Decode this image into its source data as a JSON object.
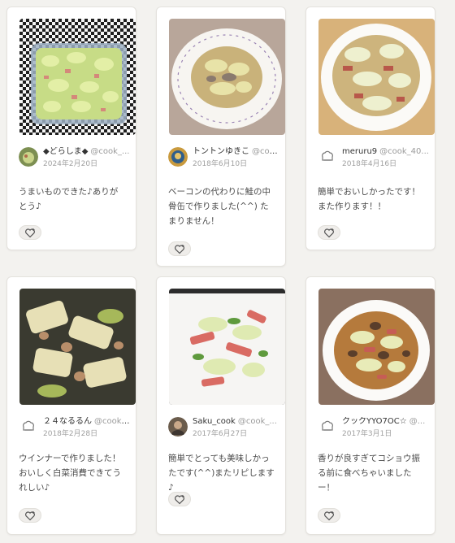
{
  "cards": [
    {
      "author": "◆どらしま◆",
      "handle": "@cook_...",
      "date": "2024年2月20日",
      "comment": "うまいものできた♪ありがとう♪",
      "avatar_icon": "food-photo-avatar",
      "photo_icon": "cabbage-bacon-glass-dish-photo"
    },
    {
      "author": "トントンゆきこ",
      "handle": "@coo...",
      "date": "2018年6月10日",
      "comment": "ベーコンの代わりに鮭の中骨缶で作りました(^^) たまりません！",
      "avatar_icon": "food-photo-avatar",
      "photo_icon": "cabbage-salmon-plate-photo"
    },
    {
      "author": "meruru9",
      "handle": "@cook_40...",
      "date": "2018年4月16日",
      "comment": "簡単でおいしかったです！また作ります！！",
      "avatar_icon": "chef-hat-icon",
      "photo_icon": "cabbage-bacon-white-plate-photo"
    },
    {
      "author": "２４なるるん",
      "handle": "@cook_...",
      "date": "2018年2月28日",
      "comment": "ウインナーで作りました！おいしく白菜消費できてうれしい♪",
      "avatar_icon": "chef-hat-icon",
      "photo_icon": "cabbage-sausage-photo"
    },
    {
      "author": "Saku_cook",
      "handle": "@cook_...",
      "date": "2017年6月27日",
      "comment": "簡単でとっても美味しかったです(^^)またリピします♪",
      "avatar_icon": "person-photo-avatar",
      "photo_icon": "cabbage-bacon-stirfry-photo"
    },
    {
      "author": "クックYYO7OC☆",
      "handle": "@...",
      "date": "2017年3月1日",
      "comment": "香りが良すぎてコショウ振る前に食べちゃいましたー！",
      "avatar_icon": "chef-hat-icon",
      "photo_icon": "cabbage-mushroom-bowl-photo"
    }
  ],
  "like_icon": "heart-plus-icon",
  "colors": {
    "background": "#f3f2ef",
    "card": "#ffffff",
    "text": "#4a4a4a",
    "muted": "#a0a0a0"
  }
}
